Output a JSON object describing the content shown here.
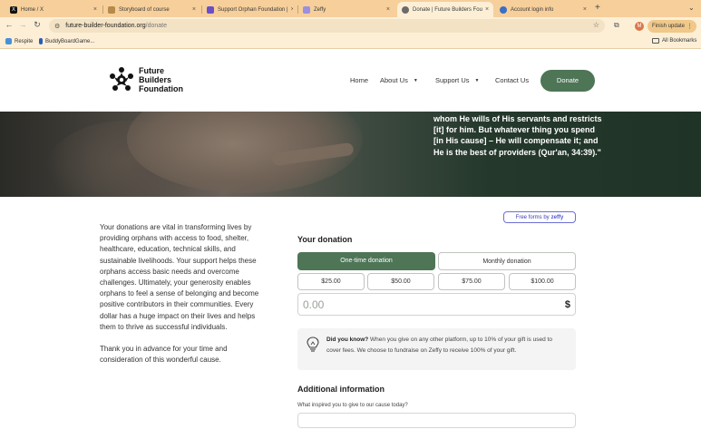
{
  "browser": {
    "tabs": [
      {
        "title": "Home / X",
        "icon": "x-icon",
        "color": "#111111"
      },
      {
        "title": "Storyboard of course",
        "icon": "doc-icon",
        "color": "#b58a4a"
      },
      {
        "title": "Support Orphan Foundation |",
        "icon": "zeffy-icon",
        "color": "#6a4fc9"
      },
      {
        "title": "Zeffy",
        "icon": "zeffy-icon",
        "color": "#9a8fe0"
      },
      {
        "title": "Donate | Future Builders Fou",
        "icon": "globe-icon",
        "color": "#6b6b6b"
      },
      {
        "title": "Account login info",
        "icon": "chat-icon",
        "color": "#3a6fc4"
      }
    ],
    "url_host": "future-builder-foundation.org",
    "url_path": "/donate",
    "profile_initial": "M",
    "finish_update": "Finish update",
    "bookmarks": [
      {
        "label": "Respite",
        "color": "#4a90d9"
      },
      {
        "label": "BuddyBoardGame...",
        "color": "#2a5bb8"
      }
    ],
    "all_bookmarks": "All Bookmarks"
  },
  "site": {
    "logo_lines": [
      "Future",
      "Builders",
      "Foundation"
    ],
    "nav": {
      "home": "Home",
      "about": "About Us",
      "support": "Support Us",
      "contact": "Contact Us",
      "donate": "Donate"
    },
    "hero_quote": "whom He wills of His servants and restricts [it] for him. But whatever thing you spend [in His cause] – He will compensate it; and He is the best of providers (Qur'an, 34:39).\""
  },
  "intro": {
    "paragraph1": "Your donations are vital in transforming lives by providing orphans with access to food, shelter, healthcare, education, technical skills, and sustainable livelihoods. Your support helps these orphans access basic needs and overcome challenges. Ultimately, your generosity enables orphans to feel a sense of belonging and become positive contributors in their communities. Every dollar has a huge impact on their lives and helps them to thrive as successful individuals.",
    "paragraph2": "Thank you in advance for your time and consideration of this wonderful cause."
  },
  "form": {
    "badge_prefix": "Free forms by",
    "badge_brand": "zeffy",
    "title": "Your donation",
    "one_time": "One-time donation",
    "monthly": "Monthly donation",
    "amounts": [
      "$25.00",
      "$50.00",
      "$75.00",
      "$100.00"
    ],
    "amount_value": "0.00",
    "currency": "$",
    "did_you_know_label": "Did you know?",
    "did_you_know_text": " When you give on any other platform, up to 10% of your gift is used to cover fees. We choose to fundraise on Zeffy to receive 100% of your gift.",
    "additional_title": "Additional information",
    "inspire_label": "What inspired you to give to our cause today?"
  },
  "colors": {
    "brand_green": "#4d7556",
    "chrome_tab_bar": "#f6cf9b"
  }
}
